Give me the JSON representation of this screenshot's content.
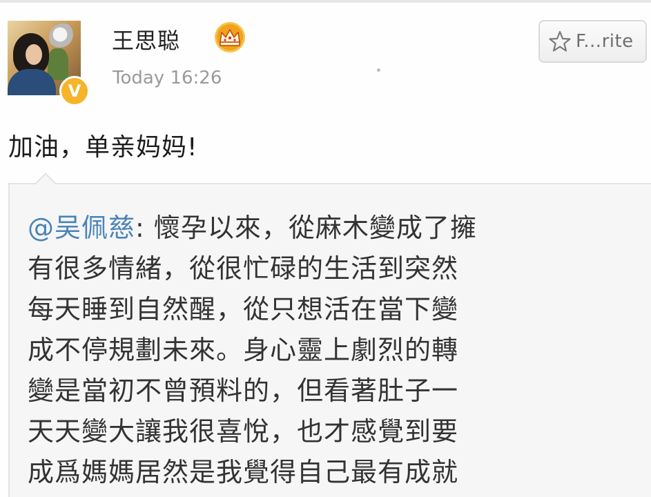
{
  "post": {
    "author": {
      "name": "王思聪",
      "verified_badge": "V"
    },
    "timestamp": "Today 16:26",
    "favorite_label": "F...rite",
    "text": "加油，单亲妈妈!"
  },
  "repost": {
    "mention": "@吴佩慈",
    "first_line_rest": ": 懷孕以來，從麻木變成了擁",
    "lines": [
      "有很多情緒，從很忙碌的生活到突然",
      "每天睡到自然醒，從只想活在當下變",
      "成不停規劃未來。身心靈上劇烈的轉",
      "變是當初不曾預料的，但看著肚子一",
      "天天變大讓我很喜悅，也才感覺到要",
      "成爲媽媽居然是我覺得自己最有成就"
    ]
  },
  "icons": {
    "crown": "crown-icon",
    "star": "star-icon",
    "verified": "verified-badge-icon"
  },
  "colors": {
    "mention": "#4b83b8",
    "verified": "#f5b42a",
    "crown": "#f0a21b"
  }
}
